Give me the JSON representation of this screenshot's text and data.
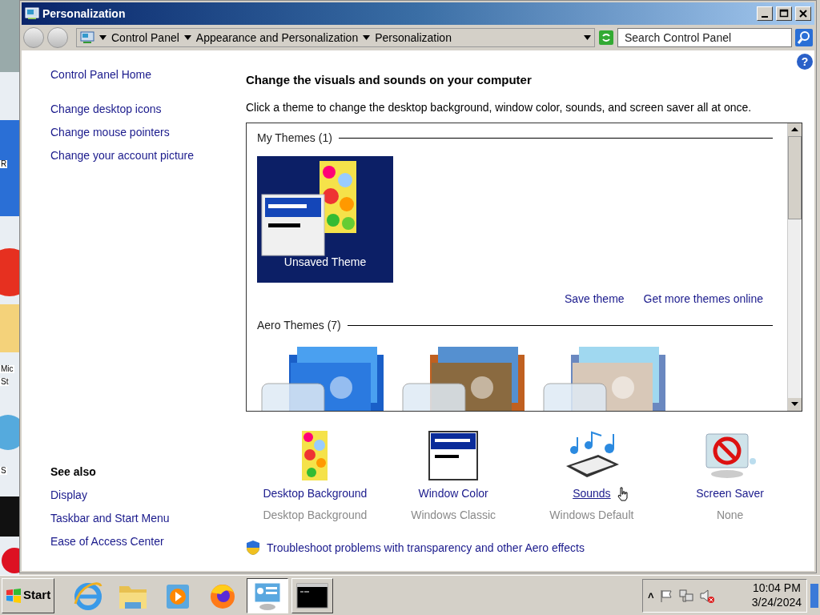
{
  "desktop_labels": [
    {
      "text": "R"
    },
    {
      "text": "Mic"
    },
    {
      "text": "St"
    },
    {
      "text": "S"
    }
  ],
  "window": {
    "title": "Personalization",
    "help": "?"
  },
  "address": {
    "crumbs": [
      "Control Panel",
      "Appearance and Personalization",
      "Personalization"
    ],
    "search_placeholder": "Search Control Panel"
  },
  "sidebar": {
    "items": [
      "Control Panel Home",
      "Change desktop icons",
      "Change mouse pointers",
      "Change your account picture"
    ],
    "see_also_title": "See also",
    "see_also": [
      "Display",
      "Taskbar and Start Menu",
      "Ease of Access Center"
    ]
  },
  "main": {
    "heading": "Change the visuals and sounds on your computer",
    "description": "Click a theme to change the desktop background, window color, sounds, and screen saver all at once.",
    "groups": [
      {
        "title": "My Themes (1)",
        "themes": [
          {
            "kind": "custom",
            "label": "Unsaved Theme",
            "selected": true
          }
        ],
        "links": [
          "Save theme",
          "Get more themes online"
        ]
      },
      {
        "title": "Aero Themes (7)",
        "themes": [
          {
            "kind": "aero"
          },
          {
            "kind": "aero"
          },
          {
            "kind": "aero"
          }
        ]
      }
    ],
    "settings": [
      {
        "kind": "background",
        "label": "Desktop Background",
        "value": "Desktop Background",
        "hover": false
      },
      {
        "kind": "color",
        "label": "Window Color",
        "value": "Windows Classic",
        "hover": false
      },
      {
        "kind": "sounds",
        "label": "Sounds",
        "value": "Windows Default",
        "hover": true
      },
      {
        "kind": "saver",
        "label": "Screen Saver",
        "value": "None",
        "hover": false
      }
    ],
    "troubleshoot": "Troubleshoot problems with transparency and other Aero effects"
  },
  "taskbar": {
    "start": "Start",
    "apps": [
      {
        "kind": "ie",
        "active": false
      },
      {
        "kind": "folder",
        "active": false
      },
      {
        "kind": "media",
        "active": false
      },
      {
        "kind": "firefox",
        "active": false
      },
      {
        "kind": "control",
        "active": true
      },
      {
        "kind": "cmd",
        "active": false
      }
    ],
    "tray_toggle": "˄",
    "time": "10:04 PM",
    "date": "3/24/2024"
  }
}
